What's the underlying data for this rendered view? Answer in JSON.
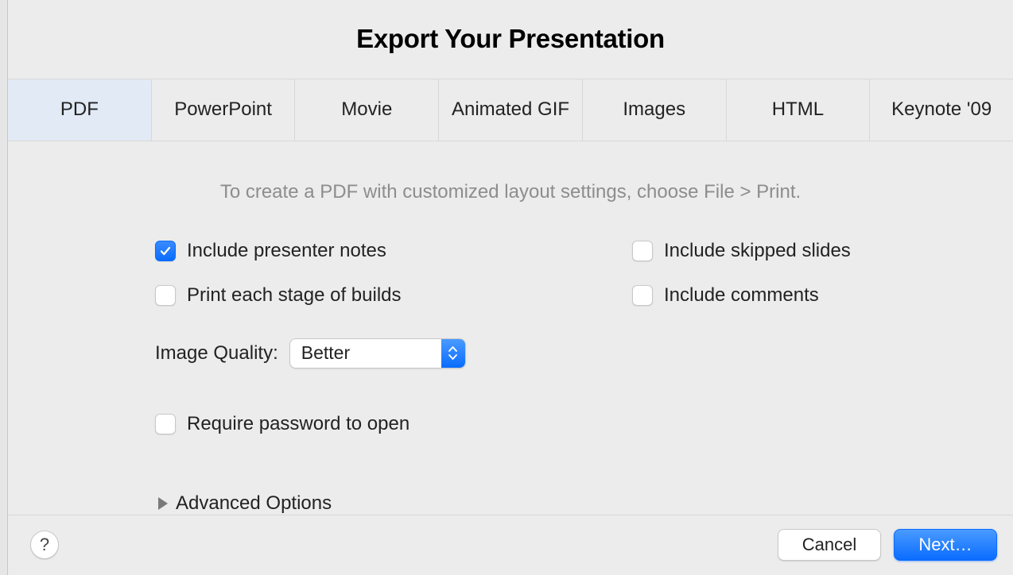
{
  "dialog": {
    "title": "Export Your Presentation"
  },
  "tabs": [
    {
      "label": "PDF",
      "selected": true
    },
    {
      "label": "PowerPoint",
      "selected": false
    },
    {
      "label": "Movie",
      "selected": false
    },
    {
      "label": "Animated GIF",
      "selected": false
    },
    {
      "label": "Images",
      "selected": false
    },
    {
      "label": "HTML",
      "selected": false
    },
    {
      "label": "Keynote '09",
      "selected": false
    }
  ],
  "hint": "To create a PDF with customized layout settings, choose File > Print.",
  "options": {
    "include_presenter_notes": {
      "label": "Include presenter notes",
      "checked": true
    },
    "include_skipped_slides": {
      "label": "Include skipped slides",
      "checked": false
    },
    "print_stage_builds": {
      "label": "Print each stage of builds",
      "checked": false
    },
    "include_comments": {
      "label": "Include comments",
      "checked": false
    },
    "image_quality_label": "Image Quality:",
    "image_quality_value": "Better",
    "require_password": {
      "label": "Require password to open",
      "checked": false
    },
    "advanced_label": "Advanced Options"
  },
  "footer": {
    "help": "?",
    "cancel": "Cancel",
    "next": "Next…"
  }
}
